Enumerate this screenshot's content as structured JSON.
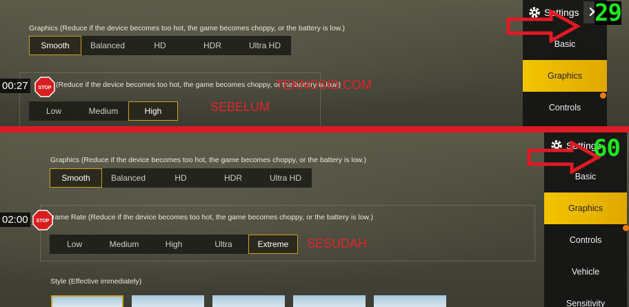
{
  "top": {
    "graphics_label": "Graphics (Reduce if the device becomes too hot, the game becomes choppy, or the battery is low.)",
    "graphics_options": [
      "Smooth",
      "Balanced",
      "HD",
      "HDR",
      "Ultra HD"
    ],
    "graphics_selected": "Smooth",
    "framerate_label": "rate (Reduce if the device becomes too hot, the game becomes choppy, or the battery is low.)",
    "framerate_options": [
      "Low",
      "Medium",
      "High"
    ],
    "framerate_selected": "High",
    "timer": "00:27",
    "stop": "STOP",
    "settings_title": "Settings",
    "fps": "29",
    "sidebar": [
      "Basic",
      "Graphics",
      "Controls"
    ],
    "sidebar_active": "Graphics",
    "watermark": "TEKNOSID.COM",
    "caption": "SEBELUM"
  },
  "bottom": {
    "graphics_label": "Graphics (Reduce if the device becomes too hot, the game becomes choppy, or the battery is low.)",
    "graphics_options": [
      "Smooth",
      "Balanced",
      "HD",
      "HDR",
      "Ultra HD"
    ],
    "graphics_selected": "Smooth",
    "framerate_label": "rame Rate (Reduce if the device becomes too hot, the game becomes choppy, or the battery is low.)",
    "framerate_options": [
      "Low",
      "Medium",
      "High",
      "Ultra",
      "Extreme"
    ],
    "framerate_selected": "Extreme",
    "style_label": "Style (Effective immediately)",
    "timer": "02:00",
    "stop": "STOP",
    "settings_title": "Settings",
    "fps": "60",
    "sidebar": [
      "Basic",
      "Graphics",
      "Controls",
      "Vehicle",
      "Sensitivity"
    ],
    "sidebar_active": "Graphics",
    "caption": "SESUDAH"
  },
  "colors": {
    "accent": "#f2c500",
    "selected_border": "#c9a227",
    "annotation_red": "#e0262c",
    "fps_green": "#1fe81f"
  },
  "icons": [
    "gear-icon",
    "close-icon",
    "stop-sign-icon",
    "arrow-right-icon"
  ]
}
